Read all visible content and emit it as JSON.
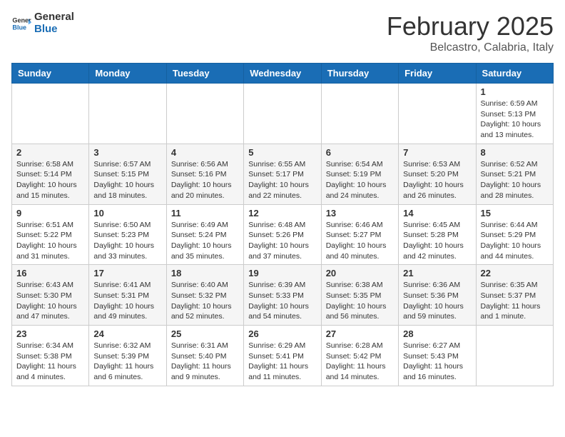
{
  "header": {
    "logo_general": "General",
    "logo_blue": "Blue",
    "month": "February 2025",
    "location": "Belcastro, Calabria, Italy"
  },
  "weekdays": [
    "Sunday",
    "Monday",
    "Tuesday",
    "Wednesday",
    "Thursday",
    "Friday",
    "Saturday"
  ],
  "weeks": [
    [
      {
        "day": "",
        "info": ""
      },
      {
        "day": "",
        "info": ""
      },
      {
        "day": "",
        "info": ""
      },
      {
        "day": "",
        "info": ""
      },
      {
        "day": "",
        "info": ""
      },
      {
        "day": "",
        "info": ""
      },
      {
        "day": "1",
        "info": "Sunrise: 6:59 AM\nSunset: 5:13 PM\nDaylight: 10 hours\nand 13 minutes."
      }
    ],
    [
      {
        "day": "2",
        "info": "Sunrise: 6:58 AM\nSunset: 5:14 PM\nDaylight: 10 hours\nand 15 minutes."
      },
      {
        "day": "3",
        "info": "Sunrise: 6:57 AM\nSunset: 5:15 PM\nDaylight: 10 hours\nand 18 minutes."
      },
      {
        "day": "4",
        "info": "Sunrise: 6:56 AM\nSunset: 5:16 PM\nDaylight: 10 hours\nand 20 minutes."
      },
      {
        "day": "5",
        "info": "Sunrise: 6:55 AM\nSunset: 5:17 PM\nDaylight: 10 hours\nand 22 minutes."
      },
      {
        "day": "6",
        "info": "Sunrise: 6:54 AM\nSunset: 5:19 PM\nDaylight: 10 hours\nand 24 minutes."
      },
      {
        "day": "7",
        "info": "Sunrise: 6:53 AM\nSunset: 5:20 PM\nDaylight: 10 hours\nand 26 minutes."
      },
      {
        "day": "8",
        "info": "Sunrise: 6:52 AM\nSunset: 5:21 PM\nDaylight: 10 hours\nand 28 minutes."
      }
    ],
    [
      {
        "day": "9",
        "info": "Sunrise: 6:51 AM\nSunset: 5:22 PM\nDaylight: 10 hours\nand 31 minutes."
      },
      {
        "day": "10",
        "info": "Sunrise: 6:50 AM\nSunset: 5:23 PM\nDaylight: 10 hours\nand 33 minutes."
      },
      {
        "day": "11",
        "info": "Sunrise: 6:49 AM\nSunset: 5:24 PM\nDaylight: 10 hours\nand 35 minutes."
      },
      {
        "day": "12",
        "info": "Sunrise: 6:48 AM\nSunset: 5:26 PM\nDaylight: 10 hours\nand 37 minutes."
      },
      {
        "day": "13",
        "info": "Sunrise: 6:46 AM\nSunset: 5:27 PM\nDaylight: 10 hours\nand 40 minutes."
      },
      {
        "day": "14",
        "info": "Sunrise: 6:45 AM\nSunset: 5:28 PM\nDaylight: 10 hours\nand 42 minutes."
      },
      {
        "day": "15",
        "info": "Sunrise: 6:44 AM\nSunset: 5:29 PM\nDaylight: 10 hours\nand 44 minutes."
      }
    ],
    [
      {
        "day": "16",
        "info": "Sunrise: 6:43 AM\nSunset: 5:30 PM\nDaylight: 10 hours\nand 47 minutes."
      },
      {
        "day": "17",
        "info": "Sunrise: 6:41 AM\nSunset: 5:31 PM\nDaylight: 10 hours\nand 49 minutes."
      },
      {
        "day": "18",
        "info": "Sunrise: 6:40 AM\nSunset: 5:32 PM\nDaylight: 10 hours\nand 52 minutes."
      },
      {
        "day": "19",
        "info": "Sunrise: 6:39 AM\nSunset: 5:33 PM\nDaylight: 10 hours\nand 54 minutes."
      },
      {
        "day": "20",
        "info": "Sunrise: 6:38 AM\nSunset: 5:35 PM\nDaylight: 10 hours\nand 56 minutes."
      },
      {
        "day": "21",
        "info": "Sunrise: 6:36 AM\nSunset: 5:36 PM\nDaylight: 10 hours\nand 59 minutes."
      },
      {
        "day": "22",
        "info": "Sunrise: 6:35 AM\nSunset: 5:37 PM\nDaylight: 11 hours\nand 1 minute."
      }
    ],
    [
      {
        "day": "23",
        "info": "Sunrise: 6:34 AM\nSunset: 5:38 PM\nDaylight: 11 hours\nand 4 minutes."
      },
      {
        "day": "24",
        "info": "Sunrise: 6:32 AM\nSunset: 5:39 PM\nDaylight: 11 hours\nand 6 minutes."
      },
      {
        "day": "25",
        "info": "Sunrise: 6:31 AM\nSunset: 5:40 PM\nDaylight: 11 hours\nand 9 minutes."
      },
      {
        "day": "26",
        "info": "Sunrise: 6:29 AM\nSunset: 5:41 PM\nDaylight: 11 hours\nand 11 minutes."
      },
      {
        "day": "27",
        "info": "Sunrise: 6:28 AM\nSunset: 5:42 PM\nDaylight: 11 hours\nand 14 minutes."
      },
      {
        "day": "28",
        "info": "Sunrise: 6:27 AM\nSunset: 5:43 PM\nDaylight: 11 hours\nand 16 minutes."
      },
      {
        "day": "",
        "info": ""
      }
    ]
  ]
}
